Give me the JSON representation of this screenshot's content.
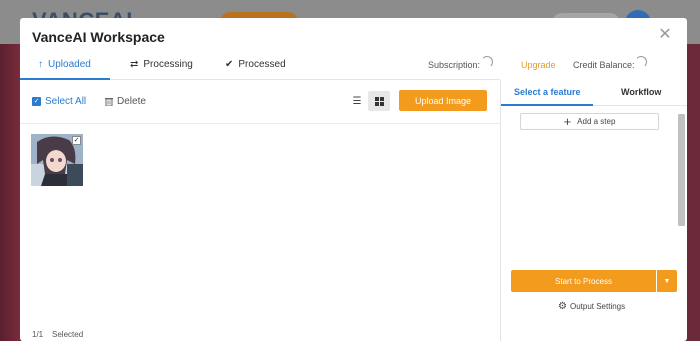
{
  "background": {
    "logo": "VANCEAI"
  },
  "modal": {
    "title": "VanceAI Workspace",
    "close_icon": "close-icon",
    "tabs": [
      {
        "label": "Uploaded",
        "icon": "arrow-up-icon"
      },
      {
        "label": "Processing",
        "icon": "sync-icon"
      },
      {
        "label": "Processed",
        "icon": "check-circle-icon"
      }
    ],
    "subscription_label": "Subscription:",
    "upgrade_label": "Upgrade",
    "credit_label": "Credit Balance:"
  },
  "toolbar": {
    "select_all": "Select All",
    "delete": "Delete",
    "upload": "Upload Image"
  },
  "status": {
    "count": "1/1",
    "selected": "Selected"
  },
  "right_panel": {
    "tabs": [
      "Select a feature",
      "Workflow"
    ],
    "add_step": "Add a step",
    "process": "Start to Process",
    "output_settings": "Output Settings"
  },
  "colors": {
    "accent": "#2b7bd1",
    "primary_button": "#f29b1d"
  }
}
